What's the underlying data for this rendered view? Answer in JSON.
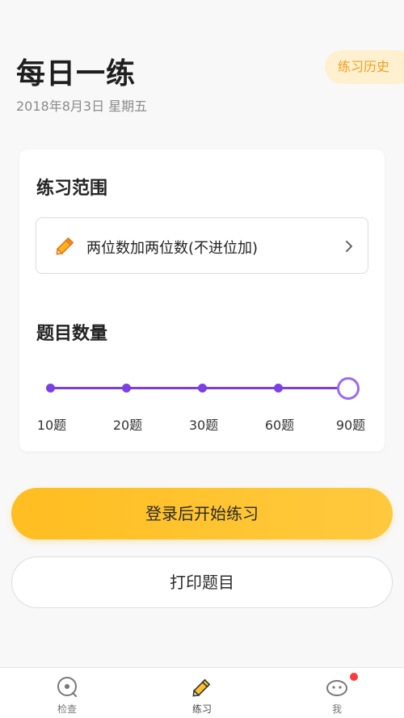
{
  "header": {
    "title": "每日一练",
    "date": "2018年8月3日 星期五",
    "history_label": "练习历史"
  },
  "range": {
    "title": "练习范围",
    "selected": "两位数加两位数(不进位加)",
    "icon": "pencil-icon"
  },
  "count": {
    "title": "题目数量",
    "options": [
      "10题",
      "20题",
      "30题",
      "60题",
      "90题"
    ],
    "selected": "90题",
    "selected_index": 4
  },
  "actions": {
    "start_label": "登录后开始练习",
    "print_label": "打印题目"
  },
  "tabbar": {
    "items": [
      {
        "label": "检查",
        "icon": "check-scan-icon"
      },
      {
        "label": "练习",
        "icon": "pencil-icon",
        "active": true
      },
      {
        "label": "我",
        "icon": "profile-icon",
        "badge": true
      }
    ]
  },
  "colors": {
    "accent": "#ffc02a",
    "slider": "#7b3fe4",
    "history_bg": "#fff0cf",
    "history_text": "#f0a020"
  }
}
